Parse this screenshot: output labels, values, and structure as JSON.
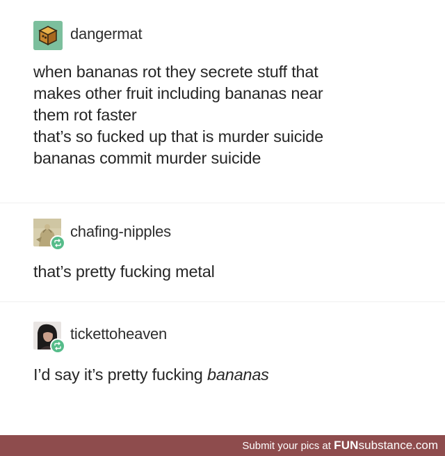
{
  "posts": [
    {
      "username": "dangermat",
      "avatar_icon": "cube-avatar-icon",
      "lines": [
        "when bananas rot they secrete stuff that",
        "makes other fruit including bananas near",
        "them rot faster",
        "that’s so fucked up that is murder suicide",
        "bananas commit murder suicide"
      ]
    },
    {
      "username": "chafing-nipples",
      "avatar_icon": "painting-avatar-icon",
      "reblog_icon": "reblog-icon",
      "lines": [
        "that’s pretty fucking metal"
      ]
    },
    {
      "username": "tickettoheaven",
      "avatar_icon": "portrait-avatar-icon",
      "reblog_icon": "reblog-icon",
      "text_before": "I’d say it’s pretty fucking ",
      "text_emphasis": "bananas"
    }
  ],
  "footer": {
    "prefix": "Submit your pics at ",
    "brand_bold": "FUN",
    "brand_light": "substance",
    "brand_suffix": ".com"
  },
  "colors": {
    "footer_bg": "#8e4c4d",
    "reblog_badge": "#56bc8a",
    "avatar_bg": "#7cbf9d"
  }
}
